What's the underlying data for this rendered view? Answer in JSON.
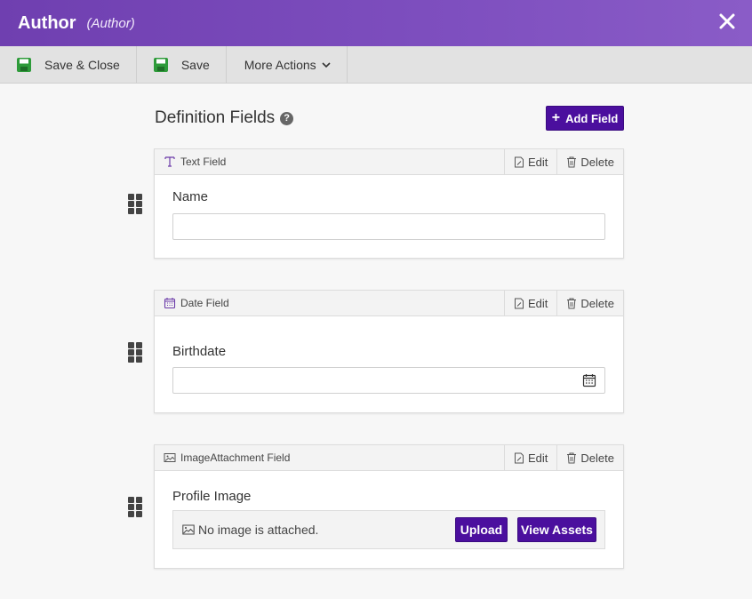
{
  "window": {
    "title": "Author",
    "subtitle": "(Author)",
    "close_icon": "close-icon"
  },
  "toolbar": {
    "save_close_label": "Save & Close",
    "save_label": "Save",
    "more_actions_label": "More Actions"
  },
  "main": {
    "heading": "Definition Fields",
    "help_glyph": "?",
    "add_field_label": "Add Field",
    "accent_color": "#4b0f9e"
  },
  "fields": [
    {
      "type_label": "Text Field",
      "type_icon": "text-field-icon",
      "edit_label": "Edit",
      "delete_label": "Delete",
      "label": "Name",
      "value": ""
    },
    {
      "type_label": "Date Field",
      "type_icon": "calendar-icon",
      "edit_label": "Edit",
      "delete_label": "Delete",
      "label": "Birthdate",
      "value": ""
    },
    {
      "type_label": "ImageAttachment Field",
      "type_icon": "image-icon",
      "edit_label": "Edit",
      "delete_label": "Delete",
      "label": "Profile Image",
      "empty_text": "No image is attached.",
      "upload_label": "Upload",
      "view_assets_label": "View Assets"
    }
  ]
}
